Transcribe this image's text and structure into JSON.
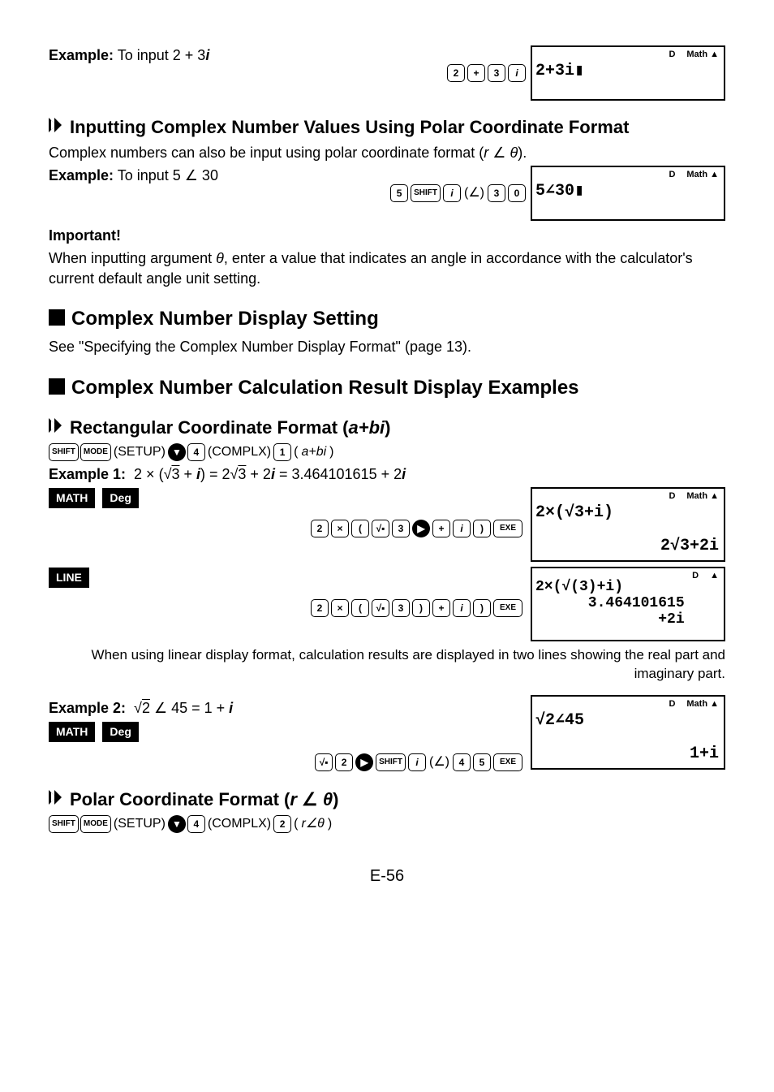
{
  "page_number": "E-56",
  "top_example": {
    "label": "Example:",
    "text": "To input 2 + 3",
    "i_suffix": "i",
    "keys": [
      "2",
      "+",
      "3",
      "i"
    ],
    "screen": {
      "status_d": "D",
      "status_math": "Math ▲",
      "line1": "2+3i▮"
    }
  },
  "polar_input": {
    "heading": "Inputting Complex Number Values Using Polar Coordinate Format",
    "intro_pre": "Complex numbers can also be input using polar coordinate format (",
    "intro_r": "r",
    "intro_angle": " ∠ ",
    "intro_theta": "θ",
    "intro_post": ").",
    "example_label": "Example:",
    "example_text": "To input 5 ∠ 30",
    "keys": [
      "5",
      "SHIFT",
      "i",
      "(∠)",
      "3",
      "0"
    ],
    "screen": {
      "status_d": "D",
      "status_math": "Math ▲",
      "line1": "5∠30▮"
    },
    "important_label": "Important!",
    "important_pre": "When inputting argument ",
    "important_theta": "θ",
    "important_post": ", enter a value that indicates an angle in accordance with the calculator's current default angle unit setting."
  },
  "display_setting": {
    "heading": "Complex Number Display Setting",
    "text": "See \"Specifying the Complex Number Display Format\" (page 13)."
  },
  "result_examples": {
    "heading": "Complex Number Calculation Result Display Examples",
    "rect": {
      "heading": "Rectangular Coordinate Format (",
      "heading_abi": "a+bi",
      "heading_close": ")",
      "setup_keys": [
        "SHIFT",
        "MODE",
        "(SETUP)",
        "▼",
        "4",
        "(COMPLX)",
        "1",
        "(",
        "a+bi",
        ")"
      ],
      "ex1": {
        "label": "Example 1:",
        "formula": "2 × (√3 + i) = 2√3 + 2i = 3.464101615 + 2i",
        "badges": [
          "MATH",
          "Deg"
        ],
        "keys_math": [
          "2",
          "×",
          "(",
          "√▪",
          "3",
          "▶",
          "+",
          "i",
          ")",
          "EXE"
        ],
        "screen_math": {
          "status_d": "D",
          "status_math": "Math ▲",
          "line1": "2×(√3+i)",
          "result": "2√3+2i"
        },
        "badge_line": "LINE",
        "keys_line": [
          "2",
          "×",
          "(",
          "√▪",
          "3",
          ")",
          "+",
          "i",
          ")",
          "EXE"
        ],
        "screen_line": {
          "status_d": "D",
          "status_tri": "▲",
          "multi": "2×(√(3)+i)\n      3.464101615\n              +2i"
        }
      },
      "note": "When using linear display format, calculation results are displayed in two lines showing the real part and imaginary part.",
      "ex2": {
        "label": "Example 2:",
        "formula": "√2 ∠ 45 = 1 + i",
        "badges": [
          "MATH",
          "Deg"
        ],
        "keys": [
          "√▪",
          "2",
          "▶",
          "SHIFT",
          "i",
          "(∠)",
          "4",
          "5",
          "EXE"
        ],
        "screen": {
          "status_d": "D",
          "status_math": "Math ▲",
          "line1": "√2∠45",
          "result": "1+i"
        }
      }
    },
    "polar": {
      "heading": "Polar Coordinate Format (",
      "heading_r": "r",
      "heading_mid": " ∠ ",
      "heading_theta": "θ",
      "heading_close": ")",
      "setup_keys": [
        "SHIFT",
        "MODE",
        "(SETUP)",
        "▼",
        "4",
        "(COMPLX)",
        "2",
        "(",
        "r∠θ",
        ")"
      ]
    }
  }
}
